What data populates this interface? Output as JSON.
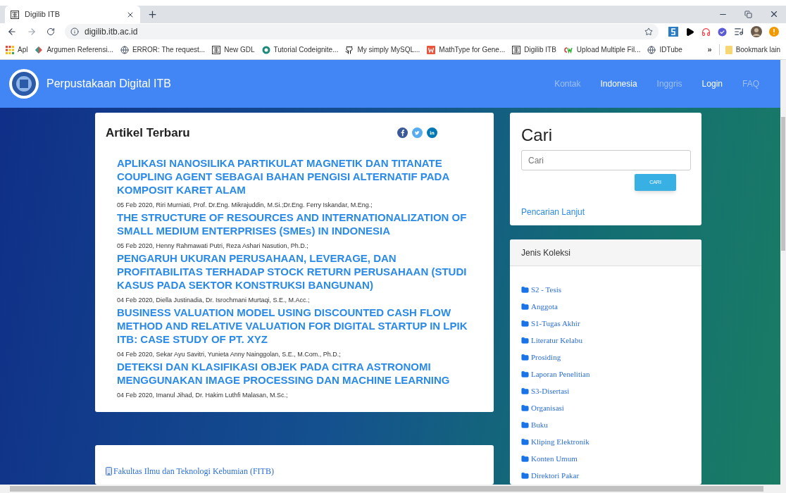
{
  "browser": {
    "tab": {
      "title": "Digilib ITB",
      "selected": true
    },
    "url": "digilib.itb.ac.id",
    "bookmarks": [
      {
        "label": "Apl",
        "kind": "apps"
      },
      {
        "label": "Argumen Referensi...",
        "kind": "leaf"
      },
      {
        "label": "ERROR: The request...",
        "kind": "globe"
      },
      {
        "label": "New GDL",
        "kind": "digilib"
      },
      {
        "label": "Tutorial Codeignite...",
        "kind": "circle"
      },
      {
        "label": "My simply MySQL...",
        "kind": "github"
      },
      {
        "label": "MathType for Gene...",
        "kind": "w"
      },
      {
        "label": "Digilib ITB",
        "kind": "digilib"
      },
      {
        "label": "Upload Multiple Fil...",
        "kind": "cw"
      },
      {
        "label": "IDTube",
        "kind": "globe"
      }
    ],
    "more": "»",
    "other_bookmarks": "Bookmark lain"
  },
  "site": {
    "title": "Perpustakaan Digital ITB",
    "nav": [
      {
        "label": "Kontak",
        "active": false
      },
      {
        "label": "Indonesia",
        "active": true
      },
      {
        "label": "Inggris",
        "active": false
      },
      {
        "label": "Login",
        "active": true
      },
      {
        "label": "FAQ",
        "active": false
      }
    ]
  },
  "articles": {
    "heading": "Artikel Terbaru",
    "items": [
      {
        "title": "APLIKASI NANOSILIKA PARTIKULAT MAGNETIK DAN TITANATE COUPLING AGENT SEBAGAI BAHAN PENGISI ALTERNATIF PADA KOMPOSIT KARET ALAM",
        "meta": "05 Feb 2020, Riri Murniati, Prof. Dr.Eng. Mikrajuddin, M.Si.;Dr.Eng. Ferry Iskandar, M.Eng.;"
      },
      {
        "title": "THE STRUCTURE OF RESOURCES AND INTERNATIONALIZATION OF SMALL MEDIUM ENTERPRISES (SMEs) IN INDONESIA",
        "meta": "05 Feb 2020, Henny Rahmawati Putri, Reza Ashari Nasution, Ph.D.;"
      },
      {
        "title": "PENGARUH UKURAN PERUSAHAAN, LEVERAGE, DAN PROFITABILITAS TERHADAP STOCK RETURN PERUSAHAAN (STUDI KASUS PADA SEKTOR KONSTRUKSI BANGUNAN)",
        "meta": "04 Feb 2020, Diella Justinadia, Dr. Isrochmani Murtaqi, S.E., M.Acc.;"
      },
      {
        "title": "BUSINESS VALUATION MODEL USING DISCOUNTED CASH FLOW METHOD AND RELATIVE VALUATION FOR DIGITAL STARTUP IN LPIK ITB: CASE STUDY OF PT. XYZ",
        "meta": "04 Feb 2020, Sekar Ayu Savitri, Yunieta Anny Nainggolan, S.E., M.Com., Ph.D.;"
      },
      {
        "title": "DETEKSI DAN KLASIFIKASI OBJEK PADA CITRA ASTRONOMI MENGGUNAKAN IMAGE PROCESSING DAN MACHINE LEARNING",
        "meta": "04 Feb 2020, Imanul Jihad, Dr. Hakim Luthfi Malasan, M.Sc.;"
      }
    ]
  },
  "faculties": [
    "Fakultas Ilmu dan Teknologi Kebumian (FITB)"
  ],
  "search": {
    "heading": "Cari",
    "placeholder": "Cari",
    "button": "CARI",
    "advanced": "Pencarian Lanjut"
  },
  "collections": {
    "heading": "Jenis Koleksi",
    "items": [
      "S2 - Tesis",
      "Anggota",
      "S1-Tugas Akhir",
      "Literatur Kelabu",
      "Prosiding",
      "Laporan Penelitian",
      "S3-Disertasi",
      "Organisasi",
      "Buku",
      "Kliping Elektronik",
      "Konten Umum",
      "Direktori Pakar"
    ]
  }
}
